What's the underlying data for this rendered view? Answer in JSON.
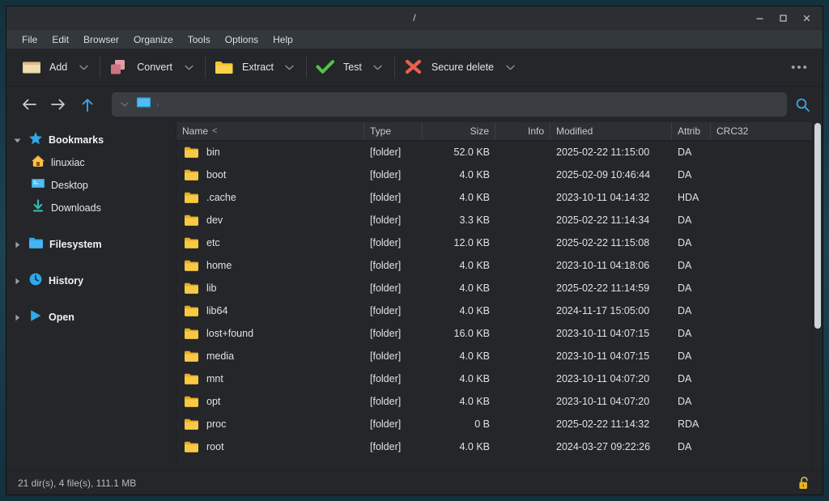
{
  "window": {
    "title": "/",
    "controls": {
      "minimize": "–",
      "maximize": "□",
      "close": "×"
    }
  },
  "menubar": {
    "items": [
      {
        "label": "File"
      },
      {
        "label": "Edit"
      },
      {
        "label": "Browser"
      },
      {
        "label": "Organize"
      },
      {
        "label": "Tools"
      },
      {
        "label": "Options"
      },
      {
        "label": "Help"
      }
    ]
  },
  "toolbar": {
    "buttons": [
      {
        "label": "Add",
        "icon": "archive-box-icon"
      },
      {
        "label": "Convert",
        "icon": "convert-squares-icon"
      },
      {
        "label": "Extract",
        "icon": "folder-open-icon"
      },
      {
        "label": "Test",
        "icon": "green-check-icon"
      },
      {
        "label": "Secure delete",
        "icon": "red-x-icon"
      }
    ],
    "overflow_label": "•••"
  },
  "navbar": {
    "back_icon": "arrow-left-icon",
    "forward_icon": "arrow-right-icon",
    "up_icon": "arrow-up-icon",
    "path_value": "",
    "path_placeholder": "",
    "path_icon": "computer-icon",
    "path_separator": "›",
    "search_icon": "search-icon"
  },
  "sidebar": {
    "items": [
      {
        "label": "Bookmarks",
        "icon": "star-icon",
        "twisty": "expanded",
        "level": 0,
        "gap_after": false
      },
      {
        "label": "linuxiac",
        "icon": "home-icon",
        "twisty": "none",
        "level": 1,
        "gap_after": false
      },
      {
        "label": "Desktop",
        "icon": "monitor-icon",
        "twisty": "none",
        "level": 1,
        "gap_after": false
      },
      {
        "label": "Downloads",
        "icon": "download-icon",
        "twisty": "none",
        "level": 1,
        "gap_after": true
      },
      {
        "label": "Filesystem",
        "icon": "folder-icon",
        "twisty": "collapsed",
        "level": 0,
        "gap_after": true
      },
      {
        "label": "History",
        "icon": "clock-icon",
        "twisty": "collapsed",
        "level": 0,
        "gap_after": true
      },
      {
        "label": "Open",
        "icon": "play-icon",
        "twisty": "collapsed",
        "level": 0,
        "gap_after": false
      }
    ]
  },
  "filelist": {
    "columns": [
      {
        "key": "name",
        "label": "Name",
        "sort": "<"
      },
      {
        "key": "type",
        "label": "Type",
        "sort": ""
      },
      {
        "key": "size",
        "label": "Size",
        "sort": ""
      },
      {
        "key": "info",
        "label": "Info",
        "sort": ""
      },
      {
        "key": "modified",
        "label": "Modified",
        "sort": ""
      },
      {
        "key": "attrib",
        "label": "Attrib",
        "sort": ""
      },
      {
        "key": "crc32",
        "label": "CRC32",
        "sort": ""
      }
    ],
    "rows": [
      {
        "name": "bin",
        "type": "[folder]",
        "size": "52.0 KB",
        "info": "",
        "modified": "2025-02-22 11:15:00",
        "attrib": "DA",
        "crc32": ""
      },
      {
        "name": "boot",
        "type": "[folder]",
        "size": "4.0 KB",
        "info": "",
        "modified": "2025-02-09 10:46:44",
        "attrib": "DA",
        "crc32": ""
      },
      {
        "name": ".cache",
        "type": "[folder]",
        "size": "4.0 KB",
        "info": "",
        "modified": "2023-10-11 04:14:32",
        "attrib": "HDA",
        "crc32": ""
      },
      {
        "name": "dev",
        "type": "[folder]",
        "size": "3.3 KB",
        "info": "",
        "modified": "2025-02-22 11:14:34",
        "attrib": "DA",
        "crc32": ""
      },
      {
        "name": "etc",
        "type": "[folder]",
        "size": "12.0 KB",
        "info": "",
        "modified": "2025-02-22 11:15:08",
        "attrib": "DA",
        "crc32": ""
      },
      {
        "name": "home",
        "type": "[folder]",
        "size": "4.0 KB",
        "info": "",
        "modified": "2023-10-11 04:18:06",
        "attrib": "DA",
        "crc32": ""
      },
      {
        "name": "lib",
        "type": "[folder]",
        "size": "4.0 KB",
        "info": "",
        "modified": "2025-02-22 11:14:59",
        "attrib": "DA",
        "crc32": ""
      },
      {
        "name": "lib64",
        "type": "[folder]",
        "size": "4.0 KB",
        "info": "",
        "modified": "2024-11-17 15:05:00",
        "attrib": "DA",
        "crc32": ""
      },
      {
        "name": "lost+found",
        "type": "[folder]",
        "size": "16.0 KB",
        "info": "",
        "modified": "2023-10-11 04:07:15",
        "attrib": "DA",
        "crc32": ""
      },
      {
        "name": "media",
        "type": "[folder]",
        "size": "4.0 KB",
        "info": "",
        "modified": "2023-10-11 04:07:15",
        "attrib": "DA",
        "crc32": ""
      },
      {
        "name": "mnt",
        "type": "[folder]",
        "size": "4.0 KB",
        "info": "",
        "modified": "2023-10-11 04:07:20",
        "attrib": "DA",
        "crc32": ""
      },
      {
        "name": "opt",
        "type": "[folder]",
        "size": "4.0 KB",
        "info": "",
        "modified": "2023-10-11 04:07:20",
        "attrib": "DA",
        "crc32": ""
      },
      {
        "name": "proc",
        "type": "[folder]",
        "size": "0 B",
        "info": "",
        "modified": "2025-02-22 11:14:32",
        "attrib": "RDA",
        "crc32": ""
      },
      {
        "name": "root",
        "type": "[folder]",
        "size": "4.0 KB",
        "info": "",
        "modified": "2024-03-27 09:22:26",
        "attrib": "DA",
        "crc32": ""
      }
    ]
  },
  "statusbar": {
    "text": "21 dir(s), 4 file(s), 111.1 MB",
    "lock_icon": "unlocked-padlock-icon"
  },
  "colors": {
    "window_bg": "#242629",
    "titlebar_bg": "#2b2f33",
    "menubar_bg": "#33383c",
    "header_bg": "#2c3034",
    "folder_yellow": "#f3c33c",
    "accent_blue": "#2fa8e8",
    "check_green": "#4ec54a",
    "delete_red": "#e8604d",
    "convert_pink": "#d9808c",
    "add_tan": "#e8cf9a",
    "lock_amber": "#e6b422",
    "text": "#dfe3e6"
  }
}
